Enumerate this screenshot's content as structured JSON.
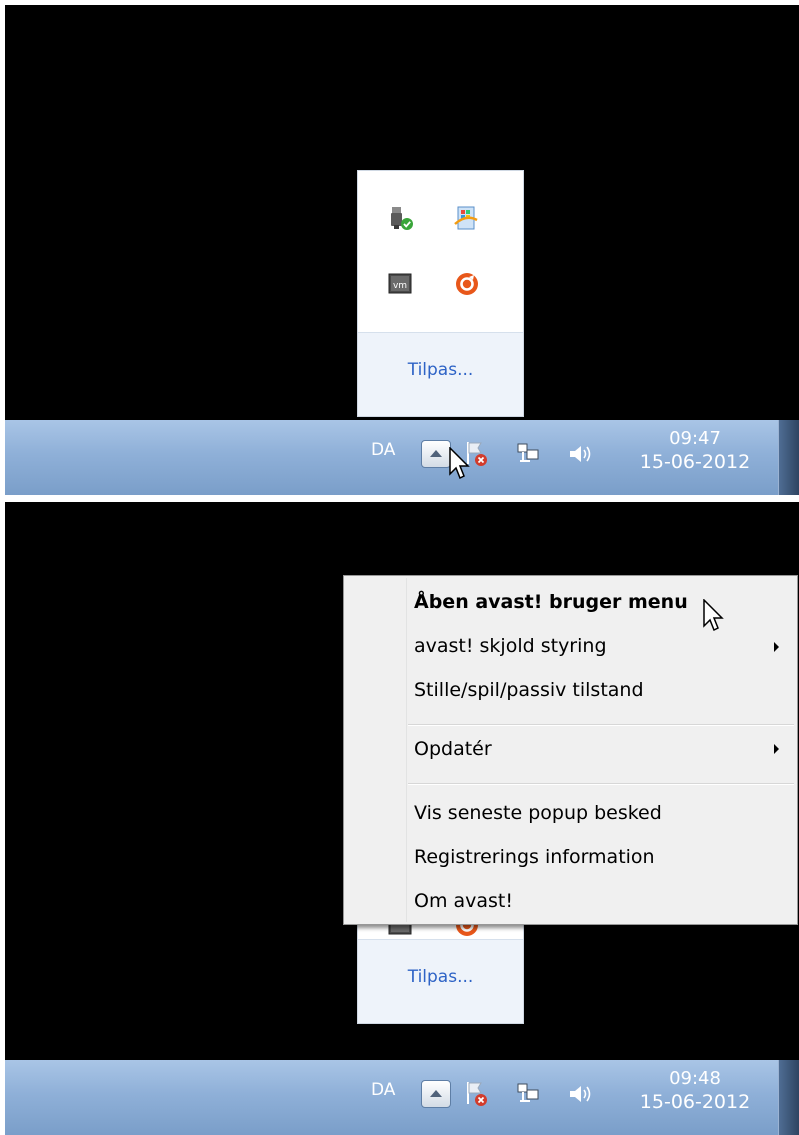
{
  "top": {
    "overflow": {
      "icons": [
        "usb-safe-remove-icon",
        "windows-update-icon",
        "vmware-tools-icon",
        "avast-icon"
      ],
      "customize_label": "Tilpas..."
    },
    "taskbar": {
      "language": "DA",
      "time": "09:47",
      "date": "15-06-2012"
    }
  },
  "bottom": {
    "context_menu": {
      "items": [
        {
          "label": "Åben avast! bruger menu",
          "bold": true,
          "submenu": false
        },
        {
          "label": "avast! skjold styring",
          "bold": false,
          "submenu": true
        },
        {
          "label": "Stille/spil/passiv tilstand",
          "bold": false,
          "submenu": false
        },
        {
          "label": "Opdatér",
          "bold": false,
          "submenu": true
        },
        {
          "label": "Vis seneste popup besked",
          "bold": false,
          "submenu": false
        },
        {
          "label": "Registrerings information",
          "bold": false,
          "submenu": false
        },
        {
          "label": "Om avast!",
          "bold": false,
          "submenu": false
        }
      ]
    },
    "overflow": {
      "customize_label": "Tilpas..."
    },
    "taskbar": {
      "language": "DA",
      "time": "09:48",
      "date": "15-06-2012"
    }
  },
  "colors": {
    "taskbar": "#8fb0d8",
    "link": "#2e63c6",
    "menu_bg": "#f0f0f0",
    "avast_orange": "#e8571a"
  }
}
